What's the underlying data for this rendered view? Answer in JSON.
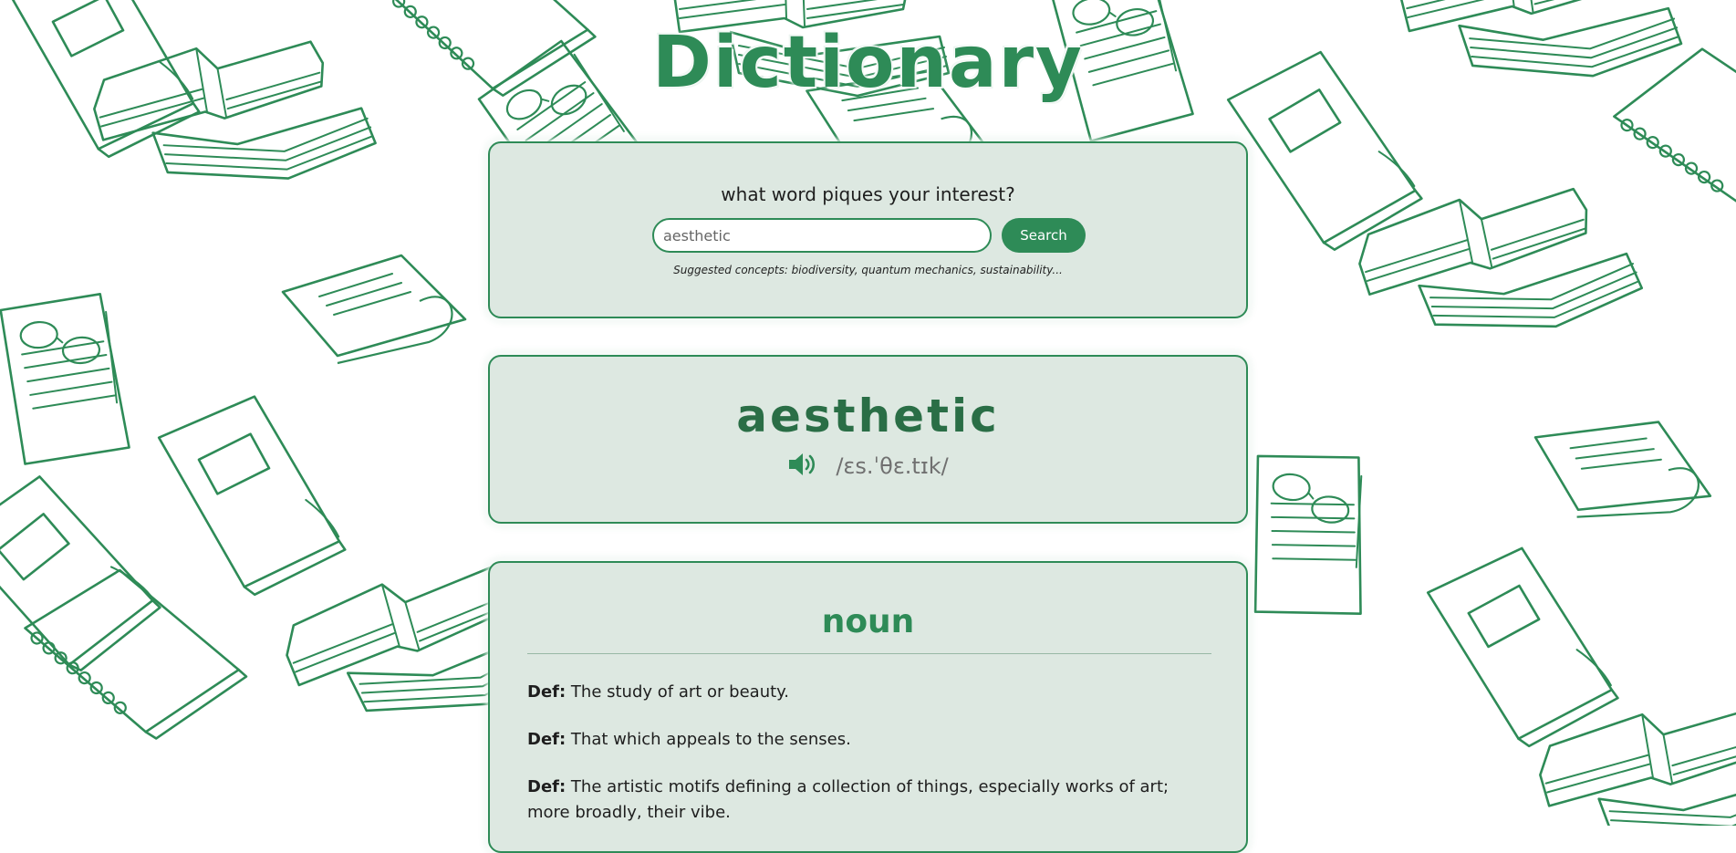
{
  "app": {
    "title": "Dictionary",
    "brand_color": "#2e8b57"
  },
  "search": {
    "prompt": "what word piques your interest?",
    "value": "aesthetic",
    "button_label": "Search",
    "suggestions": "Suggested concepts: biodiversity, quantum mechanics, sustainability..."
  },
  "entry": {
    "word": "aesthetic",
    "phonetic": "/ɛs.ˈθɛ.tɪk/",
    "audio_icon": "speaker-icon"
  },
  "meaning": {
    "part_of_speech": "noun",
    "def_label": "Def:",
    "definitions": [
      "The study of art or beauty.",
      "That which appeals to the senses.",
      "The artistic motifs defining a collection of things, especially works of art; more broadly, their vibe."
    ]
  }
}
